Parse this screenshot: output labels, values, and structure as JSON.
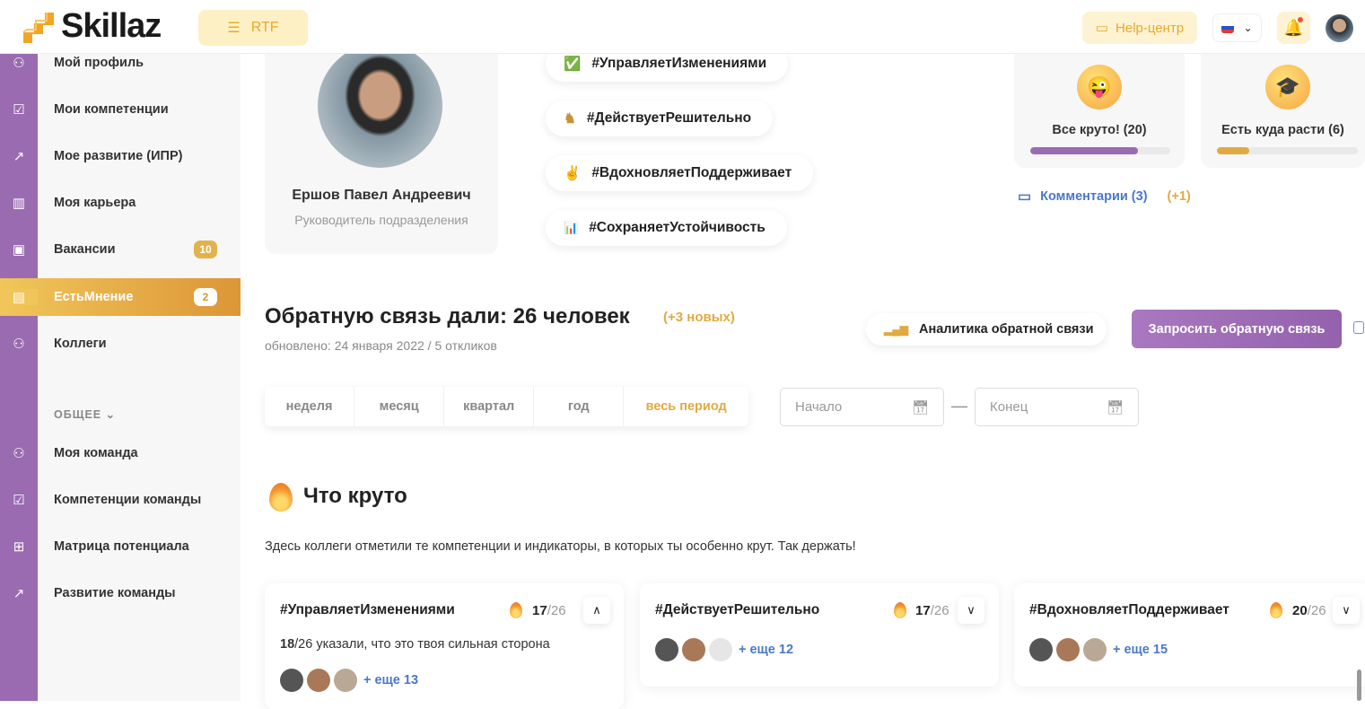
{
  "header": {
    "logo": "Skillaz",
    "org_button": "RTF",
    "help": "Help-центр",
    "language": "RU",
    "notifications": true
  },
  "sidebar": {
    "items": [
      {
        "label": "Мой профиль",
        "icon": "user-icon"
      },
      {
        "label": "Мои компетенции",
        "icon": "checkbox-icon"
      },
      {
        "label": "Мое развитие (ИПР)",
        "icon": "trend-icon"
      },
      {
        "label": "Моя карьера",
        "icon": "chart-icon"
      },
      {
        "label": "Вакансии",
        "icon": "briefcase-icon",
        "badge": "10"
      },
      {
        "label": "ЕстьМнение",
        "icon": "message-icon",
        "badge": "2",
        "active": true
      },
      {
        "label": "Коллеги",
        "icon": "users-icon"
      }
    ],
    "section": "ОБЩЕЕ",
    "common_items": [
      {
        "label": "Моя команда",
        "icon": "team-icon"
      },
      {
        "label": "Компетенции команды",
        "icon": "checkbox-icon"
      },
      {
        "label": "Матрица потенциала",
        "icon": "grid-icon"
      },
      {
        "label": "Развитие команды",
        "icon": "trend-icon"
      }
    ]
  },
  "profile": {
    "name": "Ершов Павел Андреевич",
    "role": "Руководитель подразделения"
  },
  "tags": [
    {
      "emoji": "✅",
      "label": "#УправляетИзменениями"
    },
    {
      "emoji": "♞",
      "label": "#ДействуетРешительно"
    },
    {
      "emoji": "✌",
      "label": "#ВдохновляетПоддерживает"
    },
    {
      "emoji": "📊",
      "label": "#СохраняетУстойчивость"
    }
  ],
  "ratings": [
    {
      "emoji": "😜",
      "label": "Все круто! (20)",
      "fraction": 0.77,
      "color": "#9a6bb0"
    },
    {
      "emoji": "🎓",
      "label": "Есть куда расти (6)",
      "fraction": 0.23,
      "color": "#e0aa40"
    }
  ],
  "comments": {
    "label": "Комментарии (3)",
    "new": "(+1)"
  },
  "feedback": {
    "title": "Обратную связь дали: 26 человек",
    "new": "(+3 новых)",
    "updated": "обновлено: 24 января 2022 / 5 откликов",
    "analytics": "Аналитика обратной связи",
    "request": "Запросить обратную связь"
  },
  "periods": [
    {
      "label": "неделя"
    },
    {
      "label": "месяц"
    },
    {
      "label": "квартал"
    },
    {
      "label": "год"
    },
    {
      "label": "весь период",
      "active": true
    }
  ],
  "dates": {
    "start_placeholder": "Начало",
    "end_placeholder": "Конец",
    "separator": "—"
  },
  "cool": {
    "title": "Что круто",
    "description": "Здесь коллеги отметили те компетенции и индикаторы, в которых ты особенно крут. Так держать!"
  },
  "cards": [
    {
      "title": "#УправляетИзменениями",
      "score": "17",
      "total": "/26",
      "expanded": true,
      "detail_count": "18",
      "detail_text": "/26 указали, что это твоя сильная сторона",
      "more": "+ еще 13"
    },
    {
      "title": "#ДействуетРешительно",
      "score": "17",
      "total": "/26",
      "expanded": false,
      "more": "+ еще 12"
    },
    {
      "title": "#ВдохновляетПоддерживает",
      "score": "20",
      "total": "/26",
      "expanded": false,
      "more": "+ еще 15"
    }
  ]
}
